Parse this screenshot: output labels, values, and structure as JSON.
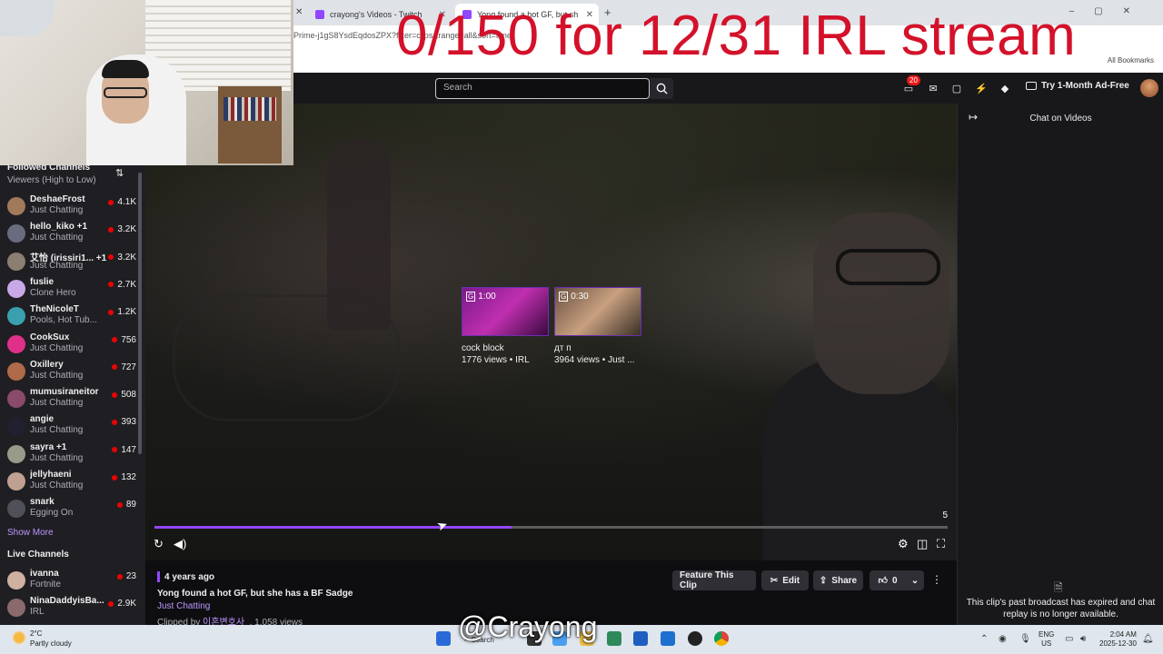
{
  "overlay": {
    "title": "0/150 for 12/31 IRL stream",
    "watermark": "@Crayong"
  },
  "browser": {
    "tabs": [
      {
        "label": "crayong's Videos - Twitch"
      },
      {
        "label": "Yong found a hot GF, but sh"
      }
    ],
    "url": "Prime-j1gS8YsdEqdosZPX?filter=clips&range=all&sort=time",
    "bookmarks_label": "All Bookmarks"
  },
  "topnav": {
    "search_placeholder": "Search",
    "notification_count": "20",
    "ad_free_label": "Try 1-Month Ad-Free"
  },
  "sidebar": {
    "followed_title": "Followed Channels",
    "sort_label": "Viewers (High to Low)",
    "channels": [
      {
        "name": "DeshaeFrost",
        "game": "Just Chatting",
        "viewers": "4.1K",
        "color": "#a07a5a"
      },
      {
        "name": "hello_kiko +1",
        "game": "Just Chatting",
        "viewers": "3.2K",
        "color": "#6b6b80"
      },
      {
        "name": "艾怡 (irissiri1... +1",
        "game": "Just Chatting",
        "viewers": "3.2K",
        "color": "#8a7f70"
      },
      {
        "name": "fuslie",
        "game": "Clone Hero",
        "viewers": "2.7K",
        "color": "#c9a8e8"
      },
      {
        "name": "TheNicoleT",
        "game": "Pools, Hot Tub...",
        "viewers": "1.2K",
        "color": "#3aa0b0"
      },
      {
        "name": "CookSux",
        "game": "Just Chatting",
        "viewers": "756",
        "color": "#e0308a"
      },
      {
        "name": "Oxillery",
        "game": "Just Chatting",
        "viewers": "727",
        "color": "#b06a4a"
      },
      {
        "name": "mumusiraneitor",
        "game": "Just Chatting",
        "viewers": "508",
        "color": "#8a4a6a"
      },
      {
        "name": "angie",
        "game": "Just Chatting",
        "viewers": "393",
        "color": "#202030"
      },
      {
        "name": "sayra +1",
        "game": "Just Chatting",
        "viewers": "147",
        "color": "#9a9a8a"
      },
      {
        "name": "jellyhaeni",
        "game": "Just Chatting",
        "viewers": "132",
        "color": "#c0a090"
      },
      {
        "name": "snark",
        "game": "Egging On",
        "viewers": "89",
        "color": "#505058"
      }
    ],
    "show_more": "Show More",
    "live_title": "Live Channels",
    "live_channels": [
      {
        "name": "ivanna",
        "game": "Fortnite",
        "viewers": "23",
        "color": "#d0b0a0"
      },
      {
        "name": "NinaDaddyisBa...",
        "game": "IRL",
        "viewers": "2.9K",
        "color": "#8a6a6a"
      }
    ]
  },
  "player": {
    "recommended": [
      {
        "duration": "1:00",
        "title": "cock block",
        "meta": "1776 views • IRL"
      },
      {
        "duration": "0:30",
        "title": "дт п",
        "meta": "3964 views • Just ..."
      }
    ],
    "countdown": "5",
    "progress": 0.45
  },
  "clip": {
    "age": "4 years ago",
    "title": "Yong found a hot GF, but she has a BF Sadge",
    "category": "Just Chatting",
    "clipped_by_label": "Clipped by",
    "clipper": "이혼변호사_",
    "views": ", 1,058 views",
    "feature_label": "Feature This Clip",
    "edit_label": "Edit",
    "share_label": "Share",
    "like_count": "0"
  },
  "chat": {
    "title": "Chat on Videos",
    "message": "This clip's past broadcast has expired and chat replay is no longer available."
  },
  "taskbar": {
    "temp": "2°C",
    "weather": "Partly cloudy",
    "search_label": "Search",
    "lang_line1": "ENG",
    "lang_line2": "US",
    "time": "2:04 AM",
    "date": "2025-12-30"
  }
}
